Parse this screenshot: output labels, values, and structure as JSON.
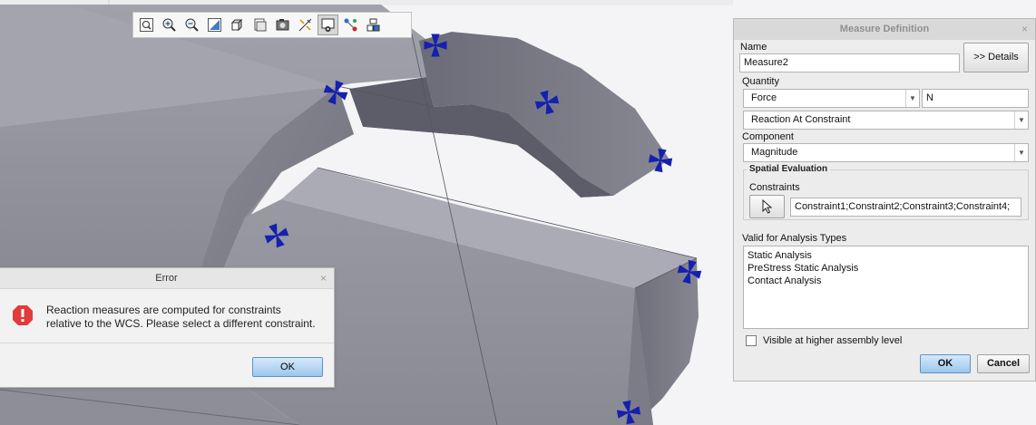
{
  "toolbar": {
    "buttons": [
      {
        "icon": "zoom-fit-icon"
      },
      {
        "icon": "zoom-in-icon"
      },
      {
        "icon": "zoom-out-icon"
      },
      {
        "icon": "refit-icon"
      },
      {
        "icon": "view-cube-icon"
      },
      {
        "icon": "saved-views-icon"
      },
      {
        "icon": "display-style-icon"
      },
      {
        "icon": "datum-display-icon"
      },
      {
        "icon": "spin-center-icon",
        "active": true
      },
      {
        "icon": "annotation-icon"
      },
      {
        "icon": "appearance-icon"
      }
    ]
  },
  "measure_dialog": {
    "title": "Measure Definition",
    "close": "×",
    "name_label": "Name",
    "name_value": "Measure2",
    "details_button": ">> Details",
    "quantity_label": "Quantity",
    "quantity_value": "Force",
    "unit_value": "N",
    "type_value": "Reaction At Constraint",
    "component_label": "Component",
    "component_value": "Magnitude",
    "spatial_group_title": "Spatial Evaluation",
    "constraints_label": "Constraints",
    "constraints_value": "Constraint1;Constraint2;Constraint3;Constraint4;",
    "valid_label": "Valid for Analysis Types",
    "analysis_types": [
      "Static Analysis",
      "PreStress Static Analysis",
      "Contact Analysis"
    ],
    "visible_checkbox_label": "Visible at higher assembly level",
    "ok_button": "OK",
    "cancel_button": "Cancel"
  },
  "error_dialog": {
    "title": "Error",
    "close": "×",
    "message_line1": "Reaction measures are computed for constraints",
    "message_line2": "relative to the WCS.  Please select a different constraint.",
    "ok_button": "OK"
  },
  "colors": {
    "model_face": "#8f8f9b",
    "constraint_marker": "#1420b0",
    "error_icon": "#e23b3b",
    "ok_button": "#a9cdf0"
  }
}
